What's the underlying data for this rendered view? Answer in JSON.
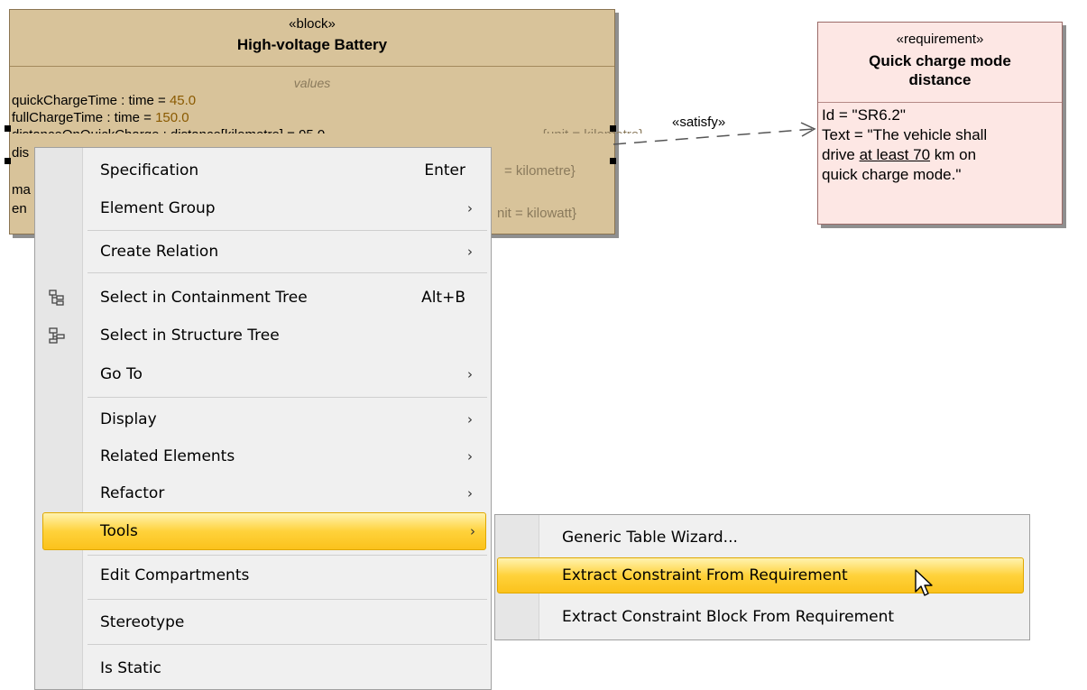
{
  "block": {
    "stereotype": "«block»",
    "name": "High-voltage Battery",
    "compartment_title": "values",
    "values": [
      {
        "label": "quickChargeTime : time = ",
        "value": "45.0"
      },
      {
        "label": "fullChargeTime : time = ",
        "value": "150.0"
      }
    ],
    "clipped_rows": [
      {
        "visible": "distanceOnQuickCharge : distance[kilometre] = 95.0",
        "suffix": "{unit = kilometre}"
      },
      {
        "visible": "dis",
        "suffix": "= kilometre}"
      },
      {
        "visible": "ma",
        "suffix": ""
      },
      {
        "visible": "en",
        "suffix": "nit = kilowatt}"
      }
    ]
  },
  "link": {
    "label": "«satisfy»"
  },
  "requirement": {
    "stereotype": "«requirement»",
    "title_line1": "Quick charge mode",
    "title_line2": "distance",
    "id_line": "Id = \"SR6.2\"",
    "text_line1": "Text = \"The vehicle shall",
    "text_line2_pre": "drive ",
    "text_line2_u": "at least 70",
    "text_line2_post": " km on",
    "text_line3": "quick charge mode.\""
  },
  "menu": {
    "items": [
      {
        "label": "Specification",
        "shortcut": "Enter"
      },
      {
        "label": "Element Group",
        "arrow": "›"
      },
      {
        "label": "Create Relation",
        "arrow": "›"
      },
      {
        "label": "Select in Containment Tree",
        "shortcut": "Alt+B",
        "icon": "containment-tree-icon"
      },
      {
        "label": "Select in Structure Tree",
        "icon": "structure-tree-icon"
      },
      {
        "label": "Go To",
        "arrow": "›"
      },
      {
        "label": "Display",
        "arrow": "›"
      },
      {
        "label": "Related Elements",
        "arrow": "›"
      },
      {
        "label": "Refactor",
        "arrow": "›"
      },
      {
        "label": "Tools",
        "arrow": "›",
        "highlighted": true
      },
      {
        "label": "Edit Compartments"
      },
      {
        "label": "Stereotype"
      },
      {
        "label": "Is Static"
      }
    ]
  },
  "submenu": {
    "items": [
      {
        "label": "Generic Table Wizard..."
      },
      {
        "label": "Extract Constraint From Requirement",
        "highlighted": true
      },
      {
        "label": "Extract Constraint Block From Requirement"
      }
    ]
  },
  "colors": {
    "block_fill": "#d8c39a",
    "requirement_fill": "#fde7e4",
    "highlight": "#ffd23b"
  }
}
